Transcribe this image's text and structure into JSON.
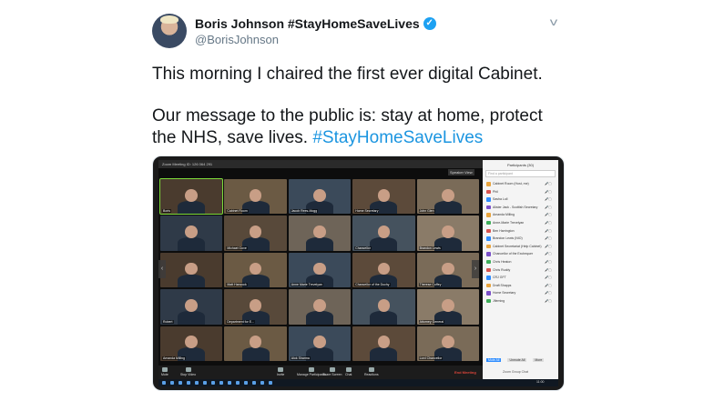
{
  "tweet": {
    "display_name": "Boris Johnson #StayHomeSaveLives",
    "handle": "@BorisJohnson",
    "verified_mark": "✓",
    "menu_caret": "v",
    "line1": "This morning I chaired the first ever digital Cabinet.",
    "line2_prefix": "Our message to the public is: stay at home, protect the NHS, save lives. ",
    "hashtag": "#StayHomeSaveLives"
  },
  "colors": {
    "link": "#1b95e0",
    "verified": "#1da1f2",
    "end_meeting": "#e0463b",
    "zoom_blue": "#2d8cff"
  },
  "photo": {
    "titlebar": "Zoom Meeting ID: 126 064 291",
    "speaker_view": "Speaker View",
    "gallery_names": [
      "Boris",
      "Cabinet Room",
      "Jacob Rees-Mogg",
      "Home Secretary",
      "John Glen",
      "",
      "Michael Gove",
      "",
      "Chancellor",
      "Brandon Lewis",
      "",
      "Matt Hancock",
      "Anne Marie Trevelyan",
      "Chancellor of the Duchy",
      "Therese Coffey",
      "Robert",
      "Department for E...",
      "",
      "",
      "Attorney General",
      "Amanda Milling",
      "",
      "Alok Sharma",
      "",
      "Lord Chancellor"
    ],
    "toolbar": [
      "Mute",
      "Stop Video",
      "Invite",
      "Manage Participants",
      "Share Screen",
      "Chat",
      "Reactions"
    ],
    "end_meeting": "End Meeting",
    "taskbar_time": "11:00",
    "participants_title": "Participants (30)",
    "find_placeholder": "Find a participant",
    "participants": [
      "Cabinet Room (Host, me)",
      "Phil",
      "Sasha Lull",
      "Alister Jack - Scottish Secretary",
      "Amanda Milling",
      "Anne-Marie Trevelyan",
      "Ben Harrington",
      "Brandon Lewis (NIO)",
      "Cabinet Secretariat (Help Cabinet)",
      "Chancellor of the Exchequer",
      "Chris Heaton",
      "Chris Ruddy",
      "CRJ GFT",
      "Draft Shapps",
      "Home Secretary",
      "Jfleming"
    ],
    "panel_buttons": [
      "Mute All",
      "Unmute All",
      "More"
    ],
    "zoom_group_chat": "Zoom Group Chat"
  }
}
